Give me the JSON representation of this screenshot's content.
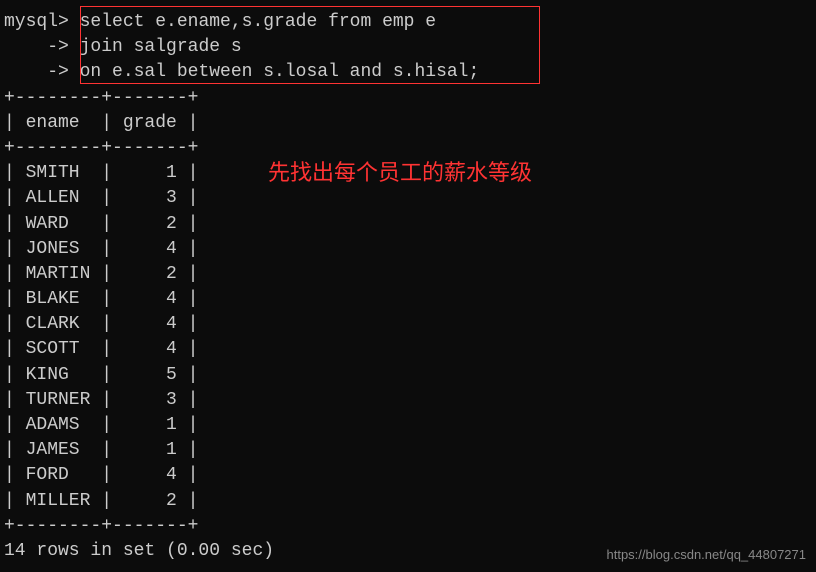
{
  "prompt": {
    "main": "mysql>",
    "cont": "    ->"
  },
  "sql": {
    "line1": "select e.ename,s.grade from emp e",
    "line2": "join salgrade s",
    "line3": "on e.sal between s.losal and s.hisal;"
  },
  "table": {
    "border": "+--------+-------+",
    "header": "| ename  | grade |",
    "rows": [
      {
        "ename": "SMITH",
        "grade": 1
      },
      {
        "ename": "ALLEN",
        "grade": 3
      },
      {
        "ename": "WARD",
        "grade": 2
      },
      {
        "ename": "JONES",
        "grade": 4
      },
      {
        "ename": "MARTIN",
        "grade": 2
      },
      {
        "ename": "BLAKE",
        "grade": 4
      },
      {
        "ename": "CLARK",
        "grade": 4
      },
      {
        "ename": "SCOTT",
        "grade": 4
      },
      {
        "ename": "KING",
        "grade": 5
      },
      {
        "ename": "TURNER",
        "grade": 3
      },
      {
        "ename": "ADAMS",
        "grade": 1
      },
      {
        "ename": "JAMES",
        "grade": 1
      },
      {
        "ename": "FORD",
        "grade": 4
      },
      {
        "ename": "MILLER",
        "grade": 2
      }
    ]
  },
  "status": "14 rows in set (0.00 sec)",
  "annotation": "先找出每个员工的薪水等级",
  "watermark": "https://blog.csdn.net/qq_44807271"
}
